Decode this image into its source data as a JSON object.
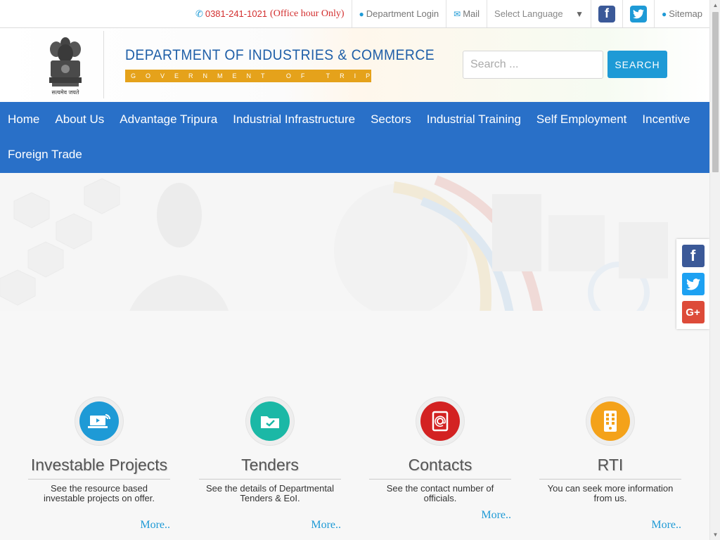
{
  "topbar": {
    "phone": "0381-241-1021",
    "office_hour": "(Office hour Only)",
    "department_login": "Department Login",
    "mail": "Mail",
    "language_label": "Select Language",
    "sitemap": "Sitemap"
  },
  "header": {
    "title": "DEPARTMENT OF INDUSTRIES & COMMERCE",
    "subtitle": "GOVERNMENT OF TRIPURA",
    "emblem_caption": "सत्यमेव जयते"
  },
  "search": {
    "placeholder": "Search ...",
    "button_label": "SEARCH"
  },
  "nav": {
    "items": [
      "Home",
      "About Us",
      "Advantage Tripura",
      "Industrial Infrastructure",
      "Sectors",
      "Industrial Training",
      "Self Employment",
      "Incentive",
      "Foreign Trade"
    ]
  },
  "cards": [
    {
      "title": "Investable Projects",
      "description": "See the resource based investable projects on offer.",
      "more": "More..",
      "icon": "laptop-wifi-icon",
      "color": "#1e9ad6"
    },
    {
      "title": "Tenders",
      "description": "See the details of Departmental Tenders & EoI.",
      "more": "More..",
      "icon": "folder-check-icon",
      "color": "#1bb8a6"
    },
    {
      "title": "Contacts",
      "description": "See the contact number of officials.",
      "more": "More..",
      "icon": "address-book-icon",
      "color": "#d32222"
    },
    {
      "title": "RTI",
      "description": "You can seek more information from us.",
      "more": "More..",
      "icon": "phone-grid-icon",
      "color": "#f4a21a"
    }
  ],
  "colors": {
    "nav_bg": "#2970c8",
    "accent": "#1e9ad6",
    "title": "#1f5fa8",
    "gov_band": "#e5a21b",
    "facebook": "#3b5998",
    "twitter": "#1da1f2",
    "googleplus": "#dd4b39"
  },
  "social_icons": [
    "facebook-icon",
    "twitter-icon",
    "google-plus-icon"
  ]
}
